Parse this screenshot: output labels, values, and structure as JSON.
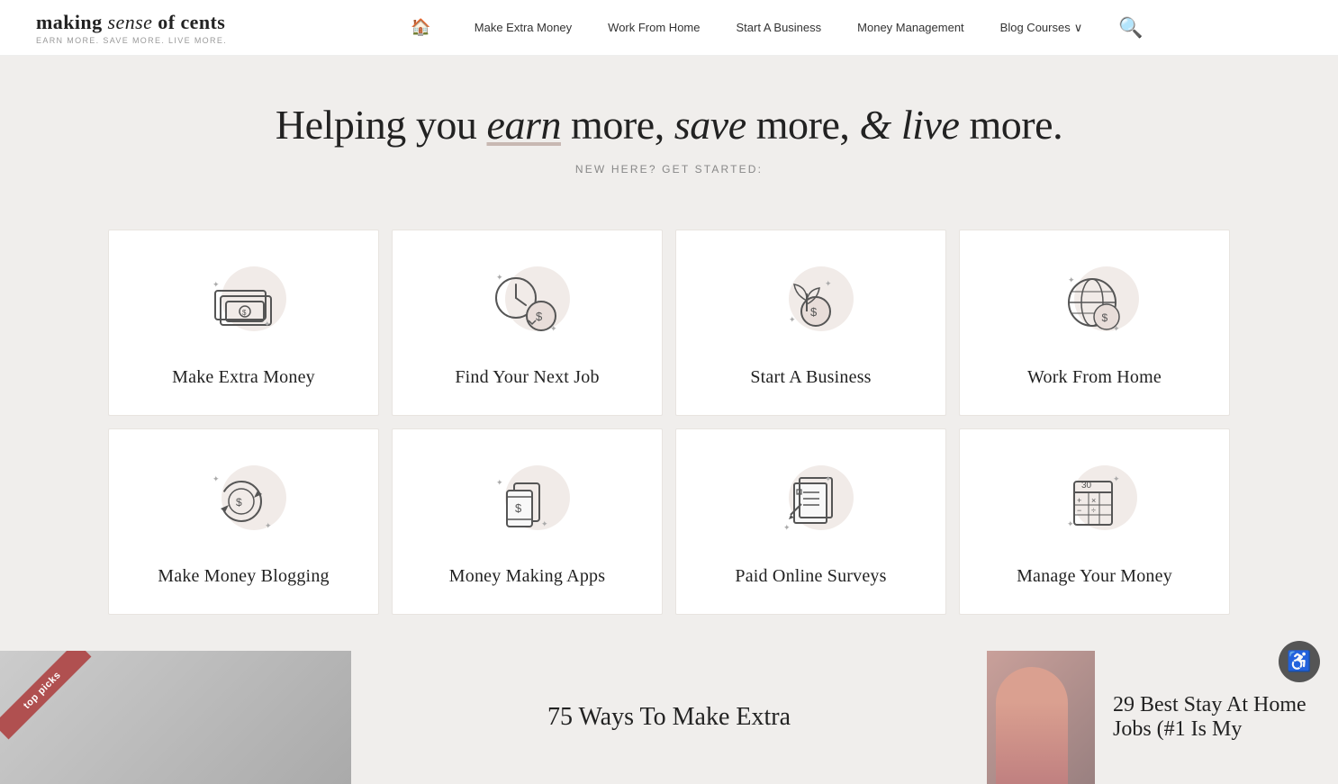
{
  "site": {
    "logo_making": "making",
    "logo_sense": " sense",
    "logo_of_cents": " of cents",
    "logo_subtitle": "EARN MORE. SAVE MORE. live MORE.",
    "title": "making sense of cents"
  },
  "nav": {
    "home_title": "Home",
    "links": [
      {
        "label": "Make Extra Money",
        "id": "make-extra-money"
      },
      {
        "label": "Work From Home",
        "id": "work-from-home"
      },
      {
        "label": "Start A Business",
        "id": "start-a-business"
      },
      {
        "label": "Money Management",
        "id": "money-management"
      },
      {
        "label": "Blog Courses",
        "id": "blog-courses"
      }
    ],
    "search_title": "Search"
  },
  "hero": {
    "heading_pre": "Helping you ",
    "heading_earn": "earn",
    "heading_mid1": " more, ",
    "heading_save": "save",
    "heading_mid2": " more, ",
    "heading_live": "& live",
    "heading_post": " more.",
    "subheading": "NEW HERE? GET STARTED:"
  },
  "cards": [
    {
      "id": "make-extra-money",
      "label": "Make Extra Money",
      "icon": "money"
    },
    {
      "id": "find-your-next-job",
      "label": "Find Your Next Job",
      "icon": "clock-coin"
    },
    {
      "id": "start-a-business",
      "label": "Start A Business",
      "icon": "plant-coin"
    },
    {
      "id": "work-from-home",
      "label": "Work From Home",
      "icon": "globe-coin"
    },
    {
      "id": "make-money-blogging",
      "label": "Make Money Blogging",
      "icon": "cycle-coin"
    },
    {
      "id": "money-making-apps",
      "label": "Money Making Apps",
      "icon": "phone-coin"
    },
    {
      "id": "paid-online-surveys",
      "label": "Paid Online Surveys",
      "icon": "survey"
    },
    {
      "id": "manage-your-money",
      "label": "Manage Your Money",
      "icon": "calendar"
    }
  ],
  "teaser": {
    "ribbon": "top picks",
    "article1_title": "75 Ways To Make Extra",
    "article2_title": "29 Best Stay At Home Jobs (#1 Is My"
  },
  "accessibility": {
    "label": "Accessibility"
  }
}
